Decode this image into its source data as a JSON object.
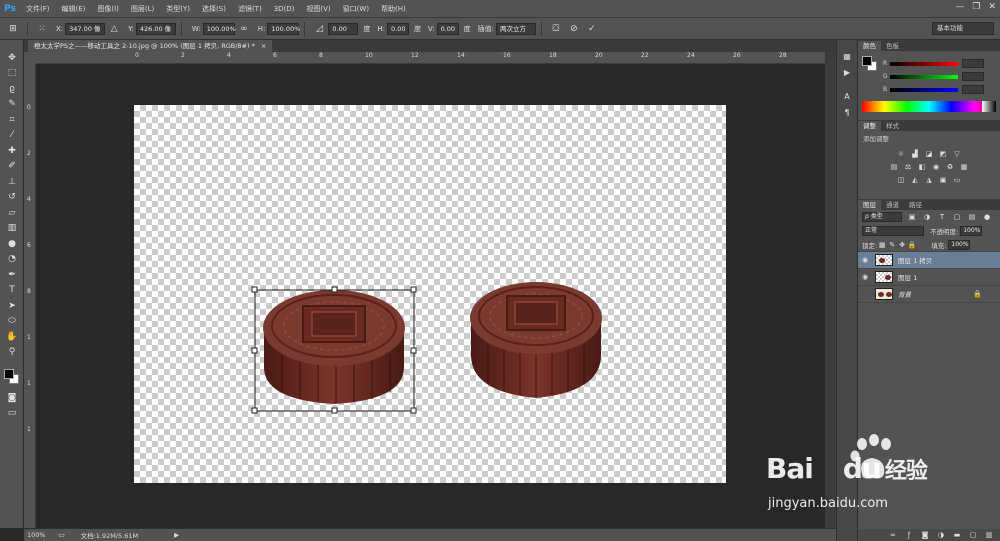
{
  "app": {
    "logo": "Ps",
    "menu": [
      "文件(F)",
      "编辑(E)",
      "图像(I)",
      "图层(L)",
      "类型(Y)",
      "选择(S)",
      "滤镜(T)",
      "3D(D)",
      "视图(V)",
      "窗口(W)",
      "帮助(H)"
    ],
    "window_controls": [
      "—",
      "❐",
      "✕"
    ]
  },
  "options": {
    "x_label": "X:",
    "x_value": "347.00 像",
    "y_label": "Y:",
    "y_value": "426.00 像",
    "w_label": "W:",
    "w_value": "100.00%",
    "link": "∞",
    "h_label": "H:",
    "h_value": "100.00%",
    "angle_value": "0.00",
    "degree1": "度",
    "hskew_label": "H:",
    "hskew_value": "0.00",
    "degree2": "度",
    "vskew_label": "V:",
    "vskew_value": "0.00",
    "degree3": "度",
    "interp_label": "插值:",
    "interp_value": "两次立方",
    "workspace": "基本功能"
  },
  "document": {
    "tab_title": "橙太太学PS之——移动工具之 2-10.jpg @ 100% (图层 1 拷贝, RGB/8#) *",
    "tab_close": "×"
  },
  "ruler": {
    "top": [
      "0",
      "2",
      "4",
      "6",
      "8",
      "10",
      "12",
      "14",
      "16",
      "18",
      "20",
      "22",
      "24",
      "26",
      "28"
    ],
    "left": [
      "0",
      "2",
      "4",
      "6",
      "8",
      "1",
      "1",
      "1"
    ]
  },
  "status": {
    "zoom": "100%",
    "doc_info": "文档:1.92M/5.61M",
    "arrow": "▶"
  },
  "panels": {
    "color_tabs": [
      "颜色",
      "色板"
    ],
    "sliders": [
      {
        "letter": "R"
      },
      {
        "letter": "G"
      },
      {
        "letter": "B"
      }
    ],
    "adjust_tabs": [
      "调整",
      "样式"
    ],
    "adjust_title": "添加调整",
    "layers_tabs": [
      "图层",
      "通道",
      "路径"
    ],
    "filter_kind": "ρ 类型",
    "blend_mode": "正常",
    "opacity_label": "不透明度:",
    "opacity_value": "100%",
    "lock_label": "锁定:",
    "fill_label": "填充:",
    "fill_value": "100%",
    "layers": [
      {
        "name": "图层 1 拷贝",
        "visible": true,
        "selected": true
      },
      {
        "name": "图层 1",
        "visible": true,
        "selected": false
      },
      {
        "name": "背景",
        "visible": false,
        "selected": false
      }
    ]
  },
  "watermark": {
    "brand_latin": "Bai",
    "brand_du": "du",
    "brand_cn": "经验",
    "url": "jingyan.baidu.com"
  },
  "colors": {
    "mooncake": "#6b2a22",
    "mooncake_dark": "#4a1a15",
    "selection_layer": "#6a7e96"
  }
}
